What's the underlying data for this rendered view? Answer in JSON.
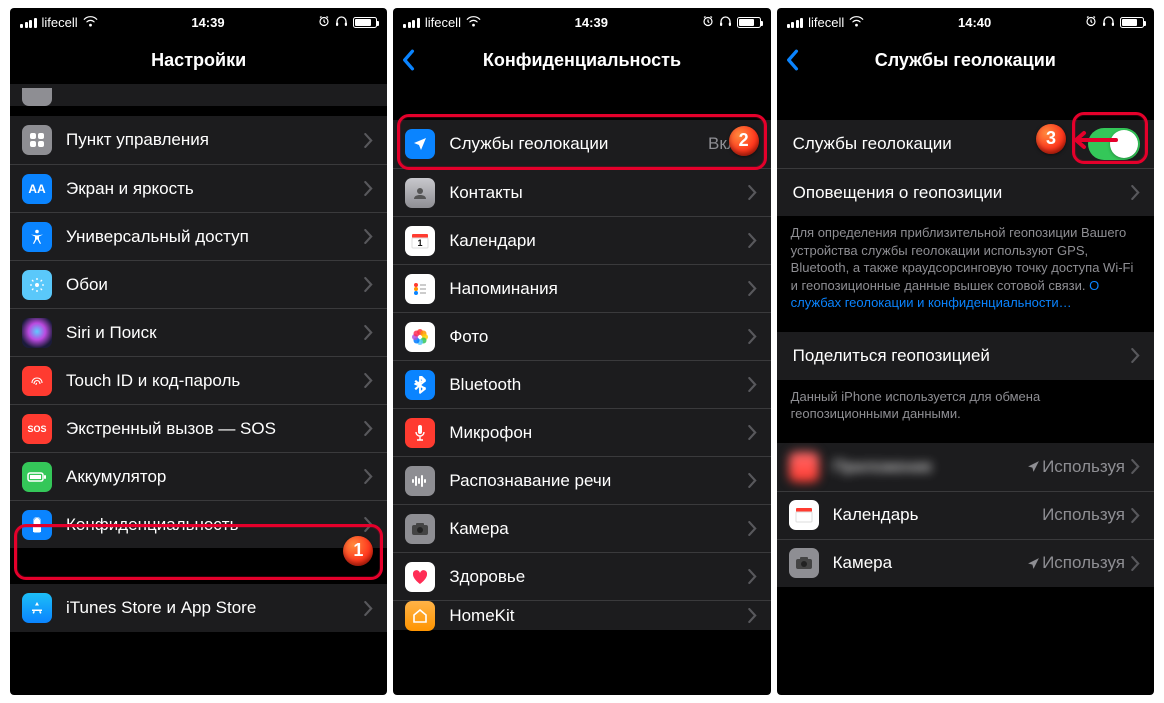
{
  "status": {
    "carrier": "lifecell",
    "time1": "14:39",
    "time2": "14:39",
    "time3": "14:40"
  },
  "p1": {
    "title": "Настройки",
    "rows": {
      "control_center": "Пункт управления",
      "display": "Экран и яркость",
      "accessibility": "Универсальный доступ",
      "wallpaper": "Обои",
      "siri": "Siri и Поиск",
      "touchid": "Touch ID и код-пароль",
      "sos": "Экстренный вызов — SOS",
      "battery": "Аккумулятор",
      "privacy": "Конфиденциальность",
      "itunes": "iTunes Store и App Store"
    }
  },
  "p2": {
    "title": "Конфиденциальность",
    "rows": {
      "location": "Службы геолокации",
      "location_val": "Вкл.",
      "contacts": "Контакты",
      "calendars": "Календари",
      "reminders": "Напоминания",
      "photos": "Фото",
      "bluetooth": "Bluetooth",
      "microphone": "Микрофон",
      "speech": "Распознавание речи",
      "camera": "Камера",
      "health": "Здоровье",
      "homekit": "HomeKit"
    }
  },
  "p3": {
    "title": "Службы геолокации",
    "rows": {
      "location_services": "Службы геолокации",
      "location_alerts": "Оповещения о геопозиции",
      "share_location": "Поделиться геопозицией",
      "app_blur": "Приложение",
      "app_calendar": "Календарь",
      "app_camera": "Камера",
      "using": "Используя"
    },
    "footer1_a": "Для определения приблизительной геопозиции Вашего устройства службы геолокации используют GPS, Bluetooth, а также краудсорсинговую точку доступа Wi-Fi и геопозиционные данные вышек сотовой связи. ",
    "footer1_link": "О службах геолокации и конфиденциальности…",
    "footer2": "Данный iPhone используется для обмена геопозиционными данными."
  },
  "markers": {
    "m1": "1",
    "m2": "2",
    "m3": "3"
  }
}
